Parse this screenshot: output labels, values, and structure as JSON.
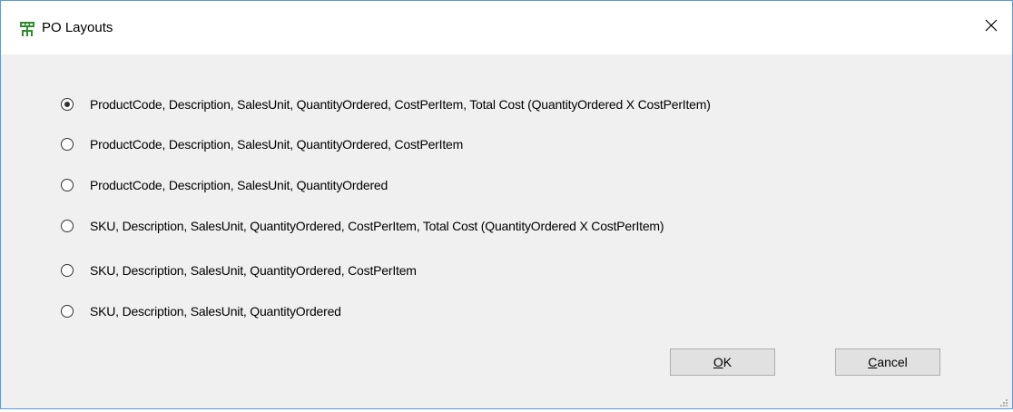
{
  "window": {
    "title": "PO Layouts",
    "icon": "org-chart-icon",
    "close_glyph": "✕"
  },
  "options": [
    {
      "label": "ProductCode, Description, SalesUnit, QuantityOrdered, CostPerItem, Total Cost (QuantityOrdered X CostPerItem)",
      "selected": true
    },
    {
      "label": "ProductCode, Description, SalesUnit, QuantityOrdered, CostPerItem",
      "selected": false
    },
    {
      "label": "ProductCode, Description, SalesUnit, QuantityOrdered",
      "selected": false
    },
    {
      "label": "SKU, Description, SalesUnit, QuantityOrdered, CostPerItem, Total Cost (QuantityOrdered X CostPerItem)",
      "selected": false
    },
    {
      "label": "SKU, Description, SalesUnit, QuantityOrdered, CostPerItem",
      "selected": false
    },
    {
      "label": "SKU, Description, SalesUnit, QuantityOrdered",
      "selected": false
    }
  ],
  "buttons": {
    "ok": {
      "mnemonic": "O",
      "rest": "K"
    },
    "cancel": {
      "mnemonic": "C",
      "rest": "ancel"
    }
  },
  "colors": {
    "border": "#5a9bd5",
    "client_bg": "#f0f0f0",
    "icon_green": "#2e8b2e"
  }
}
